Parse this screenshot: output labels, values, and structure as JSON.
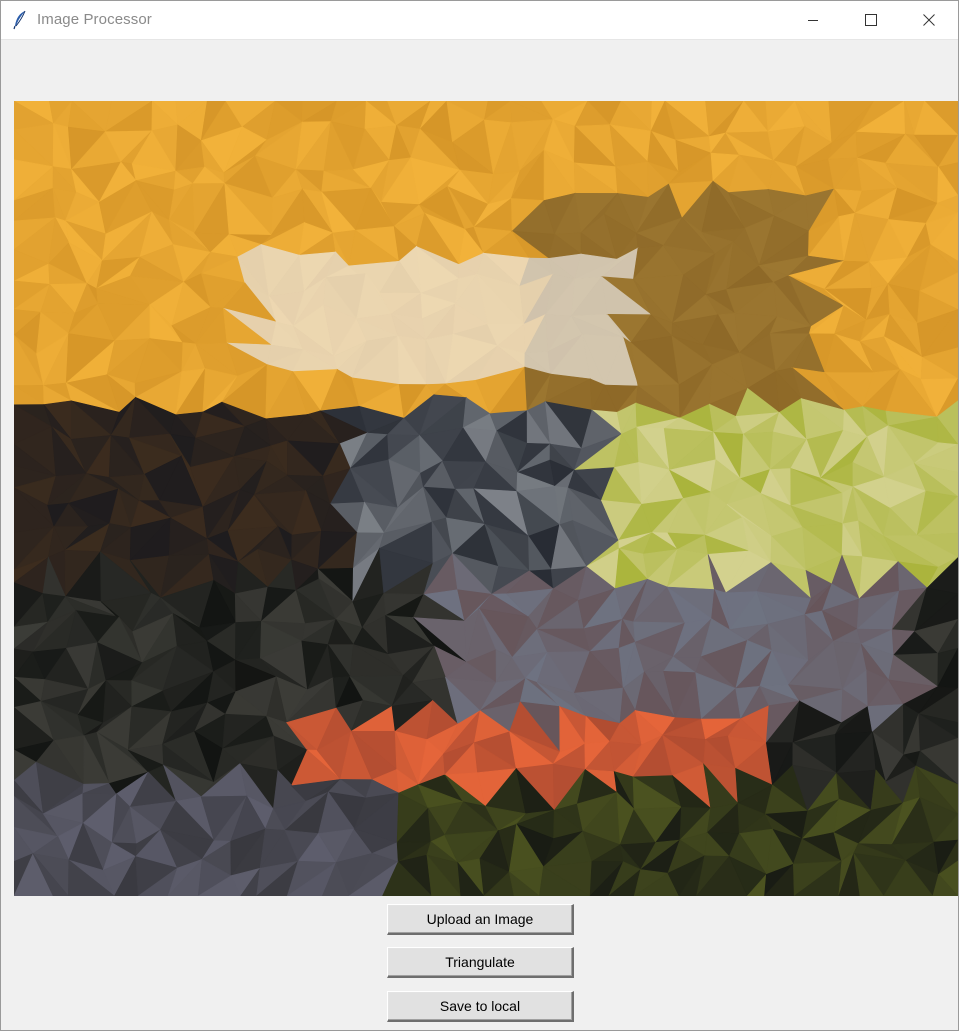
{
  "window": {
    "title": "Image Processor",
    "icon": "feather-icon",
    "controls": {
      "minimize_icon": "minimize-icon",
      "maximize_icon": "maximize-icon",
      "close_icon": "close-icon"
    }
  },
  "canvas": {
    "content": "low-poly triangulated image",
    "dominant_colors": [
      "#f2b33a",
      "#1b1b1d",
      "#6f7280",
      "#e8663a",
      "#f4f0e8",
      "#7a8a2a"
    ]
  },
  "buttons": {
    "upload": "Upload an Image",
    "triangulate": "Triangulate",
    "save": "Save to local"
  }
}
